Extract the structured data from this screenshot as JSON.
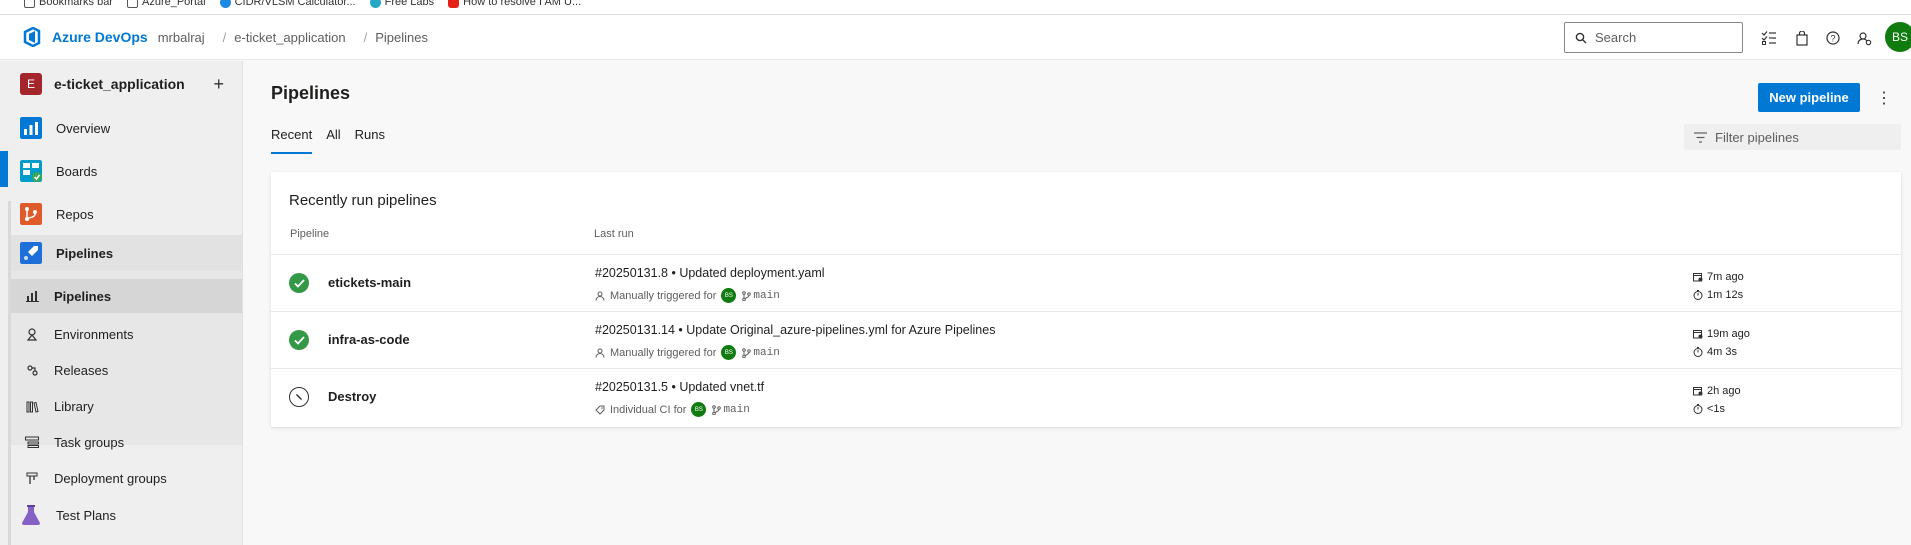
{
  "bookmarks": [
    "Bookmarks bar",
    "Azure_Portal",
    "CIDR/VLSM Calculator...",
    "Free Labs",
    "How to resolve I AM U..."
  ],
  "header": {
    "brand": "Azure DevOps",
    "breadcrumbs": [
      "mrbalraj",
      "e-ticket_application",
      "Pipelines"
    ],
    "search_placeholder": "Search",
    "user_initials": "BS"
  },
  "sidebar": {
    "project_initial": "E",
    "project_name": "e-ticket_application",
    "items": [
      {
        "label": "Overview",
        "icon": "overview-icon"
      },
      {
        "label": "Boards",
        "icon": "boards-icon"
      },
      {
        "label": "Repos",
        "icon": "repos-icon"
      },
      {
        "label": "Pipelines",
        "icon": "pipelines-icon"
      },
      {
        "label": "Pipelines",
        "icon": "pipelines-sub-icon"
      },
      {
        "label": "Environments",
        "icon": "environments-icon"
      },
      {
        "label": "Releases",
        "icon": "releases-icon"
      },
      {
        "label": "Library",
        "icon": "library-icon"
      },
      {
        "label": "Task groups",
        "icon": "task-groups-icon"
      },
      {
        "label": "Deployment groups",
        "icon": "deployment-groups-icon"
      },
      {
        "label": "Test Plans",
        "icon": "test-plans-icon"
      }
    ]
  },
  "main": {
    "title": "Pipelines",
    "new_pipeline_label": "New pipeline",
    "tabs": [
      "Recent",
      "All",
      "Runs"
    ],
    "filter_placeholder": "Filter pipelines",
    "card_title": "Recently run pipelines",
    "col_pipeline": "Pipeline",
    "col_last_run": "Last run",
    "rows": [
      {
        "name": "etickets-main",
        "status": "succeeded",
        "run_title": "#20250131.8 • Updated deployment.yaml",
        "trigger": "Manually triggered for",
        "avatar": "BS",
        "branch": "main",
        "ago": "7m ago",
        "duration": "1m 12s"
      },
      {
        "name": "infra-as-code",
        "status": "succeeded",
        "run_title": "#20250131.14 • Update Original_azure-pipelines.yml for Azure Pipelines",
        "trigger": "Manually triggered for",
        "avatar": "BS",
        "branch": "main",
        "ago": "19m ago",
        "duration": "4m 3s"
      },
      {
        "name": "Destroy",
        "status": "skipped",
        "run_title": "#20250131.5 • Updated vnet.tf",
        "trigger": "Individual CI for",
        "avatar": "BS",
        "branch": "main",
        "ago": "2h ago",
        "duration": "<1s"
      }
    ]
  },
  "colors": {
    "accent": "#0078d4",
    "success": "#339947",
    "project_badge": "#a4262c",
    "avatar": "#107c10"
  }
}
